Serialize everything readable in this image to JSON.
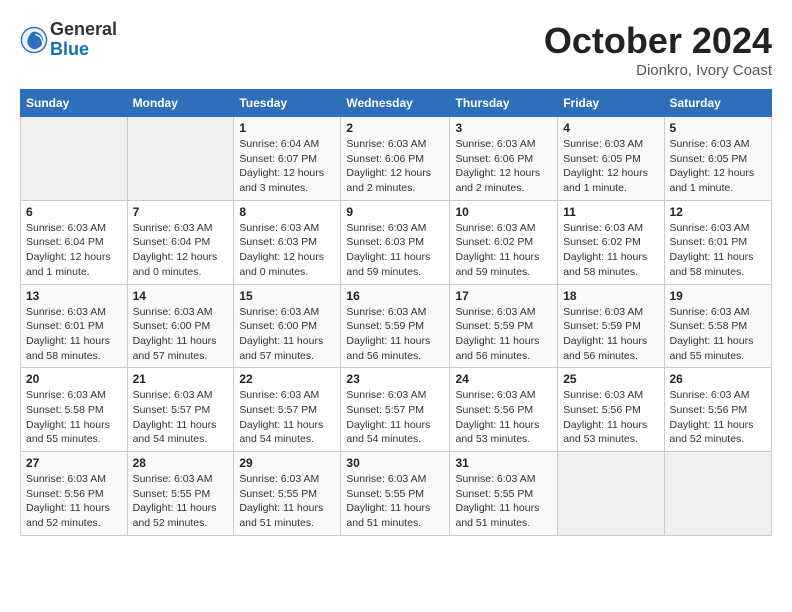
{
  "logo": {
    "general": "General",
    "blue": "Blue"
  },
  "header": {
    "month": "October 2024",
    "location": "Dionkro, Ivory Coast"
  },
  "weekdays": [
    "Sunday",
    "Monday",
    "Tuesday",
    "Wednesday",
    "Thursday",
    "Friday",
    "Saturday"
  ],
  "weeks": [
    [
      {
        "day": "",
        "info": ""
      },
      {
        "day": "",
        "info": ""
      },
      {
        "day": "1",
        "info": "Sunrise: 6:04 AM\nSunset: 6:07 PM\nDaylight: 12 hours and 3 minutes."
      },
      {
        "day": "2",
        "info": "Sunrise: 6:03 AM\nSunset: 6:06 PM\nDaylight: 12 hours and 2 minutes."
      },
      {
        "day": "3",
        "info": "Sunrise: 6:03 AM\nSunset: 6:06 PM\nDaylight: 12 hours and 2 minutes."
      },
      {
        "day": "4",
        "info": "Sunrise: 6:03 AM\nSunset: 6:05 PM\nDaylight: 12 hours and 1 minute."
      },
      {
        "day": "5",
        "info": "Sunrise: 6:03 AM\nSunset: 6:05 PM\nDaylight: 12 hours and 1 minute."
      }
    ],
    [
      {
        "day": "6",
        "info": "Sunrise: 6:03 AM\nSunset: 6:04 PM\nDaylight: 12 hours and 1 minute."
      },
      {
        "day": "7",
        "info": "Sunrise: 6:03 AM\nSunset: 6:04 PM\nDaylight: 12 hours and 0 minutes."
      },
      {
        "day": "8",
        "info": "Sunrise: 6:03 AM\nSunset: 6:03 PM\nDaylight: 12 hours and 0 minutes."
      },
      {
        "day": "9",
        "info": "Sunrise: 6:03 AM\nSunset: 6:03 PM\nDaylight: 11 hours and 59 minutes."
      },
      {
        "day": "10",
        "info": "Sunrise: 6:03 AM\nSunset: 6:02 PM\nDaylight: 11 hours and 59 minutes."
      },
      {
        "day": "11",
        "info": "Sunrise: 6:03 AM\nSunset: 6:02 PM\nDaylight: 11 hours and 58 minutes."
      },
      {
        "day": "12",
        "info": "Sunrise: 6:03 AM\nSunset: 6:01 PM\nDaylight: 11 hours and 58 minutes."
      }
    ],
    [
      {
        "day": "13",
        "info": "Sunrise: 6:03 AM\nSunset: 6:01 PM\nDaylight: 11 hours and 58 minutes."
      },
      {
        "day": "14",
        "info": "Sunrise: 6:03 AM\nSunset: 6:00 PM\nDaylight: 11 hours and 57 minutes."
      },
      {
        "day": "15",
        "info": "Sunrise: 6:03 AM\nSunset: 6:00 PM\nDaylight: 11 hours and 57 minutes."
      },
      {
        "day": "16",
        "info": "Sunrise: 6:03 AM\nSunset: 5:59 PM\nDaylight: 11 hours and 56 minutes."
      },
      {
        "day": "17",
        "info": "Sunrise: 6:03 AM\nSunset: 5:59 PM\nDaylight: 11 hours and 56 minutes."
      },
      {
        "day": "18",
        "info": "Sunrise: 6:03 AM\nSunset: 5:59 PM\nDaylight: 11 hours and 56 minutes."
      },
      {
        "day": "19",
        "info": "Sunrise: 6:03 AM\nSunset: 5:58 PM\nDaylight: 11 hours and 55 minutes."
      }
    ],
    [
      {
        "day": "20",
        "info": "Sunrise: 6:03 AM\nSunset: 5:58 PM\nDaylight: 11 hours and 55 minutes."
      },
      {
        "day": "21",
        "info": "Sunrise: 6:03 AM\nSunset: 5:57 PM\nDaylight: 11 hours and 54 minutes."
      },
      {
        "day": "22",
        "info": "Sunrise: 6:03 AM\nSunset: 5:57 PM\nDaylight: 11 hours and 54 minutes."
      },
      {
        "day": "23",
        "info": "Sunrise: 6:03 AM\nSunset: 5:57 PM\nDaylight: 11 hours and 54 minutes."
      },
      {
        "day": "24",
        "info": "Sunrise: 6:03 AM\nSunset: 5:56 PM\nDaylight: 11 hours and 53 minutes."
      },
      {
        "day": "25",
        "info": "Sunrise: 6:03 AM\nSunset: 5:56 PM\nDaylight: 11 hours and 53 minutes."
      },
      {
        "day": "26",
        "info": "Sunrise: 6:03 AM\nSunset: 5:56 PM\nDaylight: 11 hours and 52 minutes."
      }
    ],
    [
      {
        "day": "27",
        "info": "Sunrise: 6:03 AM\nSunset: 5:56 PM\nDaylight: 11 hours and 52 minutes."
      },
      {
        "day": "28",
        "info": "Sunrise: 6:03 AM\nSunset: 5:55 PM\nDaylight: 11 hours and 52 minutes."
      },
      {
        "day": "29",
        "info": "Sunrise: 6:03 AM\nSunset: 5:55 PM\nDaylight: 11 hours and 51 minutes."
      },
      {
        "day": "30",
        "info": "Sunrise: 6:03 AM\nSunset: 5:55 PM\nDaylight: 11 hours and 51 minutes."
      },
      {
        "day": "31",
        "info": "Sunrise: 6:03 AM\nSunset: 5:55 PM\nDaylight: 11 hours and 51 minutes."
      },
      {
        "day": "",
        "info": ""
      },
      {
        "day": "",
        "info": ""
      }
    ]
  ]
}
